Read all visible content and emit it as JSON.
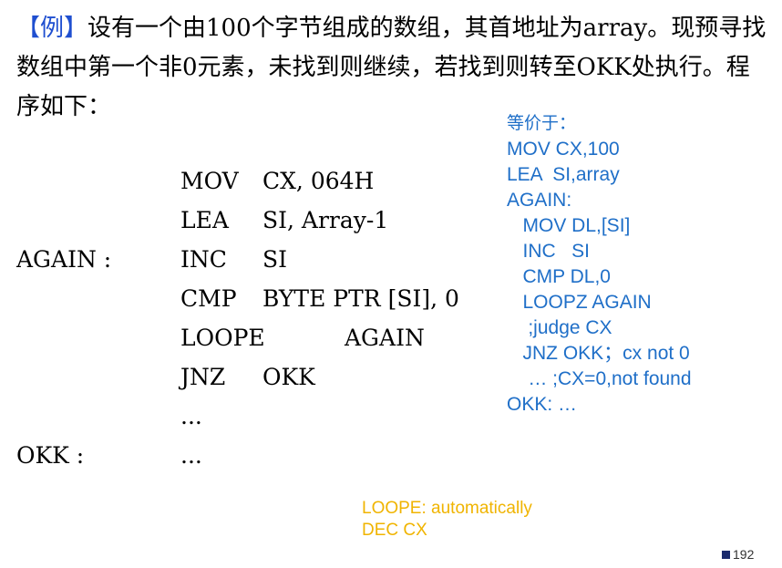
{
  "intro": {
    "tag": "【例】",
    "text": "设有一个由100个字节组成的数组，其首地址为array。现预寻找数组中第一个非0元素，未找到则继续，若找到则转至OKK处执行。程序如下："
  },
  "code": {
    "rows": [
      {
        "label": "",
        "op": "MOV",
        "arg": "CX, 064H"
      },
      {
        "label": "",
        "op": "LEA",
        "arg": "SI, Array-1"
      },
      {
        "label": "AGAIN :",
        "op": "INC",
        "arg": "SI"
      },
      {
        "label": "",
        "op": "CMP",
        "arg": "BYTE PTR [SI], 0"
      },
      {
        "label": "",
        "op": "LOOPE",
        "arg": "AGAIN"
      },
      {
        "label": "",
        "op": "JNZ",
        "arg": "OKK"
      },
      {
        "label": "",
        "op": "...",
        "arg": ""
      },
      {
        "label": "OKK :",
        "op": "...",
        "arg": ""
      }
    ]
  },
  "equiv": {
    "title": "等价于：",
    "lines": [
      "MOV CX,100",
      "LEA  SI,array",
      "AGAIN:",
      "   MOV DL,[SI]",
      "   INC   SI",
      "   CMP DL,0",
      "   LOOPZ AGAIN",
      "    ;judge CX",
      "   JNZ OKK；cx not 0",
      "    … ;CX=0,not found",
      "OKK: …"
    ]
  },
  "note": {
    "line1": "LOOPE: automatically",
    "line2": "DEC CX"
  },
  "page_number": "192",
  "colors": {
    "accent_blue": "#1f6fc8",
    "note_yellow": "#f0b400"
  }
}
